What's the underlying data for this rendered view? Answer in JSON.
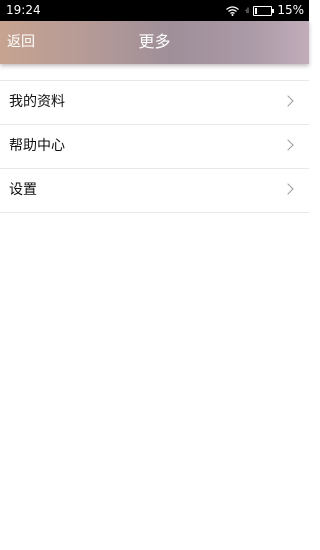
{
  "status_bar": {
    "time": "19:24",
    "battery": "15%",
    "battery_level": 0.15,
    "icons": [
      "wifi-icon",
      "signal-icon",
      "battery-icon"
    ]
  },
  "navbar": {
    "back_label": "返回",
    "title": "更多"
  },
  "menu": {
    "items": [
      {
        "label": "我的资料",
        "icon": "chevron-right-icon"
      },
      {
        "label": "帮助中心",
        "icon": "chevron-right-icon"
      },
      {
        "label": "设置",
        "icon": "chevron-right-icon"
      }
    ]
  },
  "colors": {
    "status_bar_bg": "#000000",
    "navbar_gradient": [
      "#c7a390",
      "#9f8f99",
      "#c1acba"
    ],
    "divider": "#e8e8e8",
    "chevron": "#9a9a9a"
  }
}
